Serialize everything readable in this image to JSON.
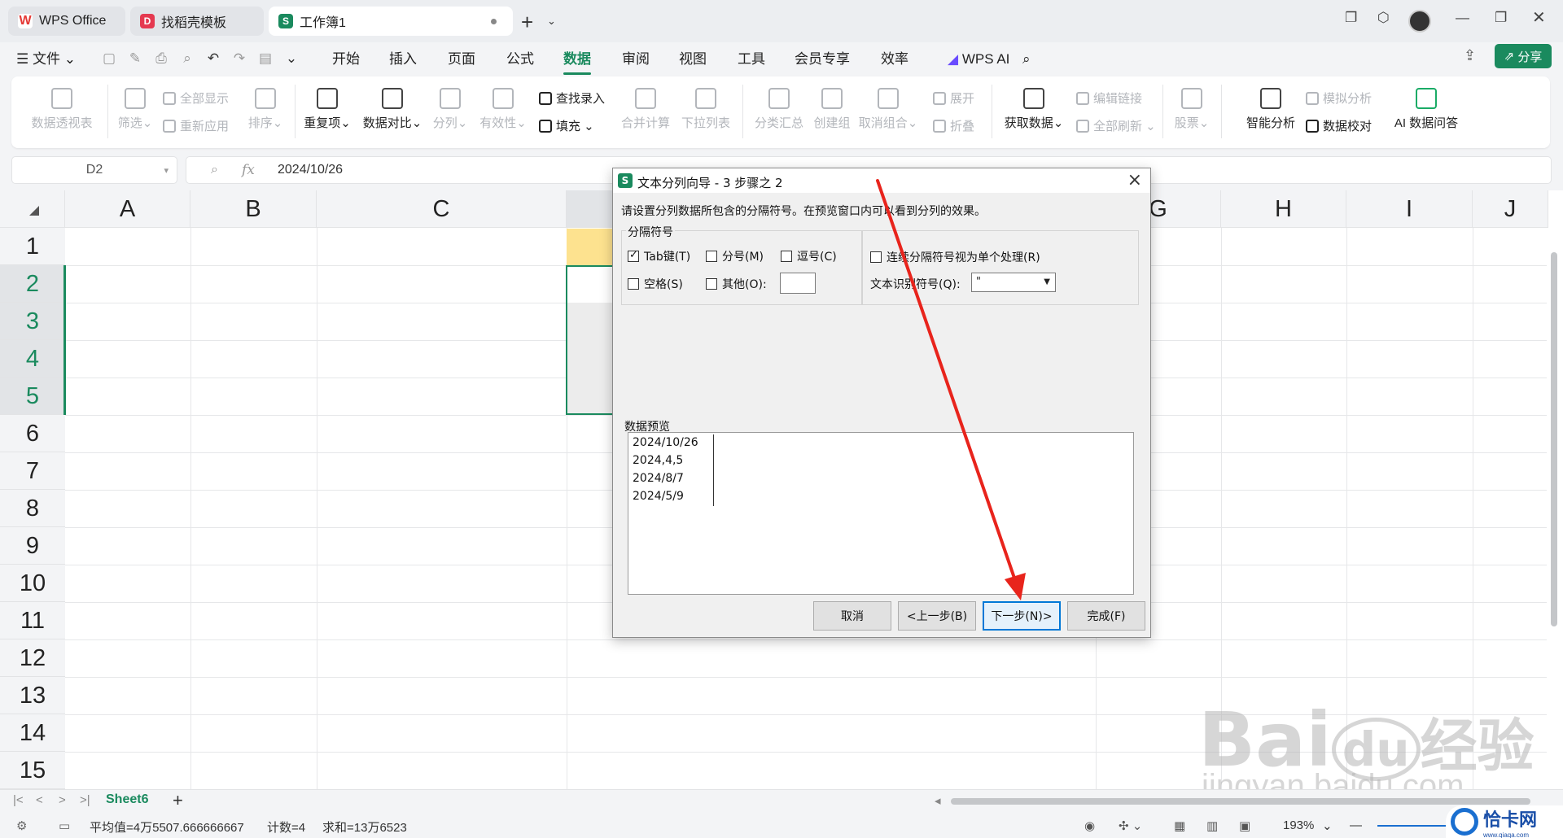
{
  "tabs": [
    {
      "label": "WPS Office",
      "icon_letter": "W",
      "color": "#e53935"
    },
    {
      "label": "找稻壳模板",
      "icon_letter": "D",
      "color": "#e53950"
    },
    {
      "label": "工作簿1",
      "icon_letter": "S",
      "color": "#1a8a5e"
    }
  ],
  "menu": {
    "file": "文件",
    "items": [
      "开始",
      "插入",
      "页面",
      "公式",
      "数据",
      "审阅",
      "视图",
      "工具",
      "会员专享",
      "效率"
    ],
    "active": "数据",
    "wps_ai": "WPS AI",
    "share": "分享"
  },
  "ribbon": {
    "pivot": "数据透视表",
    "filter": "筛选",
    "show_all": "全部显示",
    "reapply": "重新应用",
    "sort": "排序",
    "duplicates": "重复项",
    "compare": "数据对比",
    "split": "分列",
    "validity": "有效性",
    "lookup": "查找录入",
    "fill": "填充",
    "consolidate": "合并计算",
    "dropdown": "下拉列表",
    "subtotal": "分类汇总",
    "group": "创建组",
    "ungroup": "取消组合",
    "expand": "展开",
    "collapse": "折叠",
    "get_data": "获取数据",
    "edit_links": "编辑链接",
    "refresh_all": "全部刷新",
    "stocks": "股票",
    "smart_analysis": "智能分析",
    "simulation": "模拟分析",
    "data_check": "数据校对",
    "ai_qa": "AI 数据问答"
  },
  "formula_bar": {
    "cell_ref": "D2",
    "fx": "fx",
    "value": "2024/10/26"
  },
  "sheet": {
    "columns": [
      "A",
      "B",
      "C",
      "",
      "",
      "",
      "G",
      "H",
      "I",
      "J"
    ],
    "rows": [
      "1",
      "2",
      "3",
      "4",
      "5",
      "6",
      "7",
      "8",
      "9",
      "10",
      "11",
      "12",
      "13",
      "14",
      "15"
    ],
    "tab_name": "Sheet6"
  },
  "status": {
    "average": "平均值=4万5507.666666667",
    "count": "计数=4",
    "sum": "求和=13万6523",
    "zoom": "193%"
  },
  "dialog": {
    "title": "文本分列向导 - 3 步骤之 2",
    "intro": "请设置分列数据所包含的分隔符号。在预览窗口内可以看到分列的效果。",
    "delimiters_label": "分隔符号",
    "tab": "Tab键(T)",
    "semicolon": "分号(M)",
    "comma": "逗号(C)",
    "space": "空格(S)",
    "other": "其他(O):",
    "consecutive": "连续分隔符号视为单个处理(R)",
    "qualifier_label": "文本识别符号(Q):",
    "qualifier_value": "\"",
    "preview_label": "数据预览",
    "preview_lines": [
      "2024/10/26",
      "2024,4,5",
      "2024/8/7",
      "2024/5/9"
    ],
    "buttons": {
      "cancel": "取消",
      "back": "<上一步(B)",
      "next": "下一步(N)>",
      "finish": "完成(F)"
    }
  },
  "watermark": {
    "baidu": "Bai",
    "du": "du",
    "jingyan": "经验",
    "url": "jingyan.baidu.com",
    "qiaka": "恰卡网",
    "qiaka_url": "www.qiaqa.com"
  }
}
